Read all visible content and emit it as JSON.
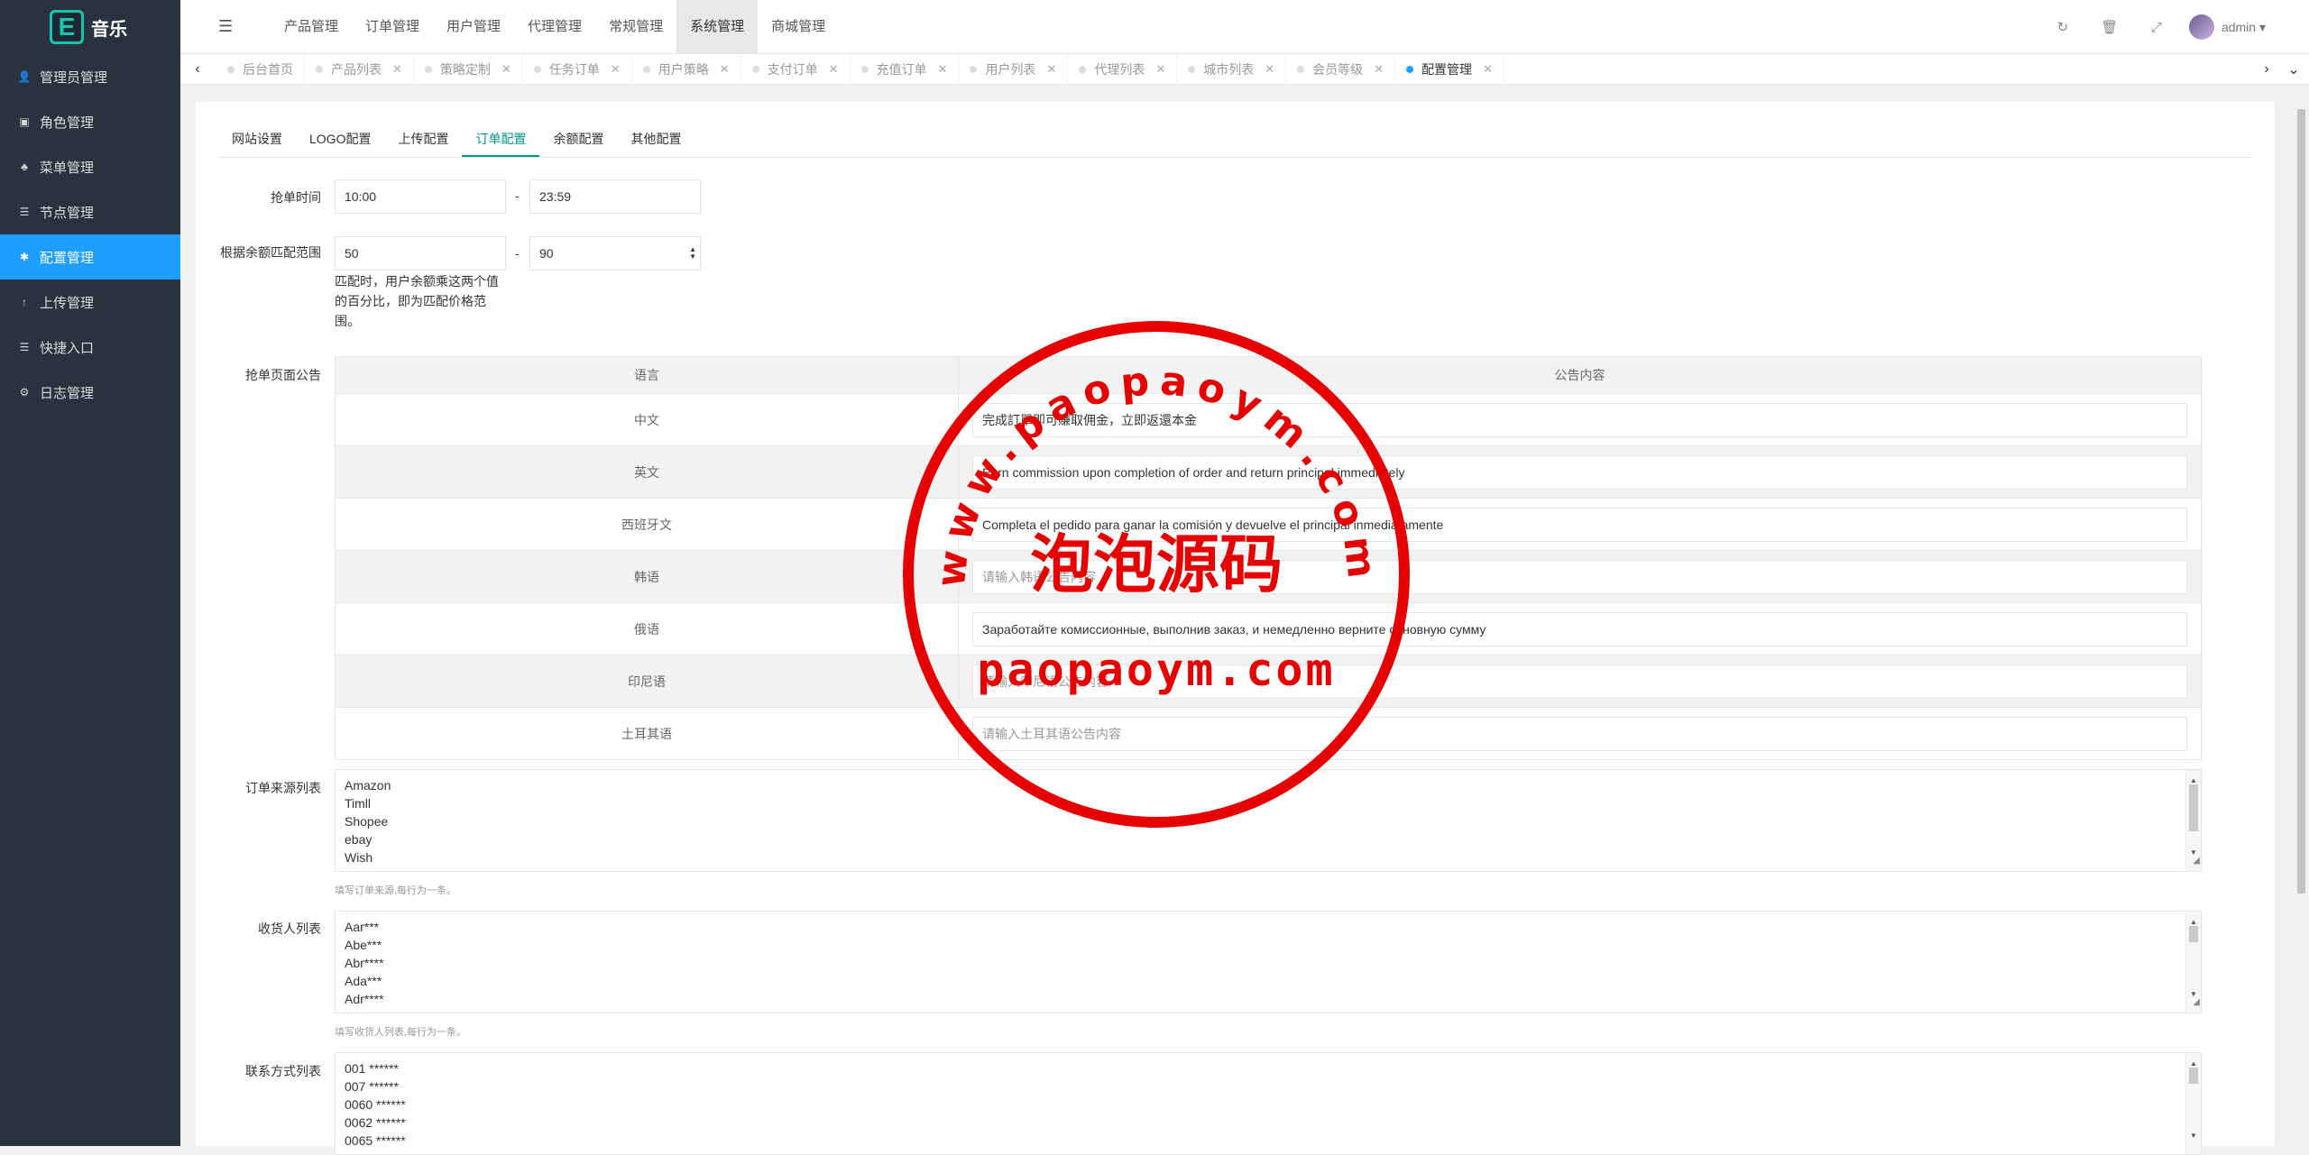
{
  "app": {
    "logo_letter": "E",
    "logo_text": "音乐"
  },
  "sidebar": {
    "items": [
      {
        "label": "管理员管理",
        "icon": "user-icon",
        "glyph": "👤"
      },
      {
        "label": "角色管理",
        "icon": "id-card-icon",
        "glyph": "▣"
      },
      {
        "label": "菜单管理",
        "icon": "bell-icon",
        "glyph": "♣"
      },
      {
        "label": "节点管理",
        "icon": "list-icon",
        "glyph": "☰"
      },
      {
        "label": "配置管理",
        "icon": "gear-icon",
        "glyph": "✱"
      },
      {
        "label": "上传管理",
        "icon": "upload-icon",
        "glyph": "↑"
      },
      {
        "label": "快捷入口",
        "icon": "list-icon",
        "glyph": "☰"
      },
      {
        "label": "日志管理",
        "icon": "settings-circle-icon",
        "glyph": "⚙"
      }
    ]
  },
  "topmenu": [
    "产品管理",
    "订单管理",
    "用户管理",
    "代理管理",
    "常规管理",
    "系统管理",
    "商城管理"
  ],
  "header": {
    "user": "admin"
  },
  "tabs": [
    "后台首页",
    "产品列表",
    "策略定制",
    "任务订单",
    "用户策略",
    "支付订单",
    "充值订单",
    "用户列表",
    "代理列表",
    "城市列表",
    "会员等级",
    "配置管理"
  ],
  "subtabs": [
    "网站设置",
    "LOGO配置",
    "上传配置",
    "订单配置",
    "余额配置",
    "其他配置"
  ],
  "form": {
    "grab_time_label": "抢单时间",
    "grab_time_start": "10:00",
    "grab_time_dash": "-",
    "grab_time_end": "23:59",
    "match_label": "根据余额匹配范围",
    "match_min": "50",
    "match_dash": "-",
    "match_max": "90",
    "match_hint": "匹配时，用户余额乘这两个值的百分比，即为匹配价格范围。",
    "notice_label": "抢单页面公告",
    "notice_head_lang": "语言",
    "notice_head_content": "公告内容",
    "notices": [
      {
        "lang": "中文",
        "value": "完成訂單即可賺取佣金，立即返還本金",
        "placeholder": ""
      },
      {
        "lang": "英文",
        "value": "Earn commission upon completion of order and return principal immediately",
        "placeholder": ""
      },
      {
        "lang": "西班牙文",
        "value": "Completa el pedido para ganar la comisión y devuelve el principal inmediatamente",
        "placeholder": ""
      },
      {
        "lang": "韩语",
        "value": "",
        "placeholder": "请输入韩语公告内容"
      },
      {
        "lang": "俄语",
        "value": "Заработайте комиссионные, выполнив заказ, и немедленно верните основную сумму",
        "placeholder": ""
      },
      {
        "lang": "印尼语",
        "value": "",
        "placeholder": "请输入印尼语公告内容"
      },
      {
        "lang": "土耳其语",
        "value": "",
        "placeholder": "请输入土耳其语公告内容"
      }
    ],
    "source_label": "订单来源列表",
    "source_lines": [
      "Amazon",
      "Timll",
      "Shopee",
      "ebay",
      "Wish"
    ],
    "source_tip": "填写订单来源,每行为一条。",
    "receiver_label": "收货人列表",
    "receiver_lines": [
      "Aar***",
      "Abe***",
      "Abr****",
      "Ada***",
      "Adr****"
    ],
    "receiver_tip": "填写收货人列表,每行为一条。",
    "contact_label": "联系方式列表",
    "contact_lines": [
      "001 ******",
      "007 ******",
      "0060 ******",
      "0062 ******",
      "0065 ******"
    ]
  },
  "watermark": {
    "top_arc": "www.paopaoym.com",
    "center": "泡泡源码",
    "bottom": "paopaoym.com",
    "color": "#e60000"
  }
}
